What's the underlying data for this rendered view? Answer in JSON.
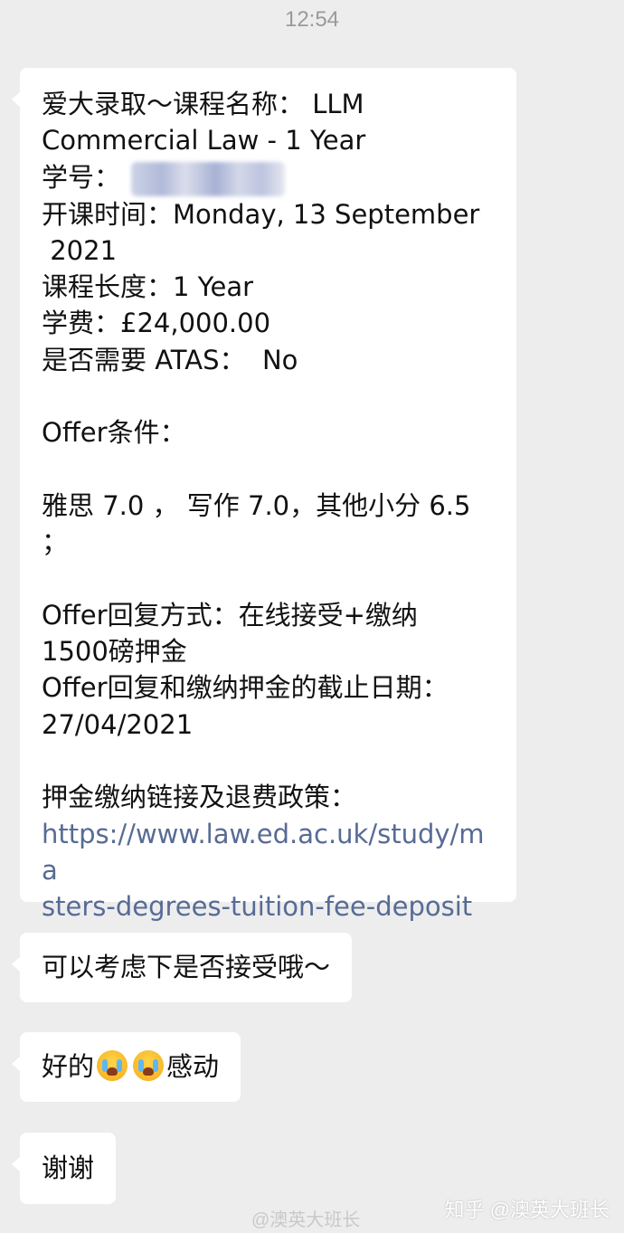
{
  "timestamp": "12:54",
  "message1": {
    "line1": "爱大录取～课程名称： LLM",
    "line2": "Commercial Law - 1 Year",
    "student_id_label": "学号：",
    "line4": "开课时间：Monday, 13 September",
    "line5": " 2021",
    "line6": "课程长度：1 Year",
    "line7": "学费：£24,000.00",
    "line8": "是否需要 ATAS：  No",
    "line10": "Offer条件：",
    "line12": "雅思 7.0 ， 写作 7.0，其他小分 6.5",
    "line13": "；",
    "line15": "Offer回复方式：在线接受+缴纳",
    "line16": "1500磅押金",
    "line17": "Offer回复和缴纳押金的截止日期：",
    "line18": "27/04/2021",
    "line20": "押金缴纳链接及退费政策：",
    "link_line1": "https://www.law.ed.ac.uk/study/ma",
    "link_line2": "sters-degrees-tuition-fee-deposit"
  },
  "message2": {
    "text": "可以考虑下是否接受哦～"
  },
  "message3": {
    "prefix": "好的",
    "suffix": "感动",
    "emoji": "loudly-crying-face"
  },
  "message4": {
    "text": "谢谢"
  },
  "watermark_left": "@澳英大班长",
  "watermark_right": "知乎 @澳英大班长",
  "colors": {
    "background": "#ededed",
    "bubble": "#ffffff",
    "link": "#576b95",
    "timestamp": "#9a9a9a"
  }
}
